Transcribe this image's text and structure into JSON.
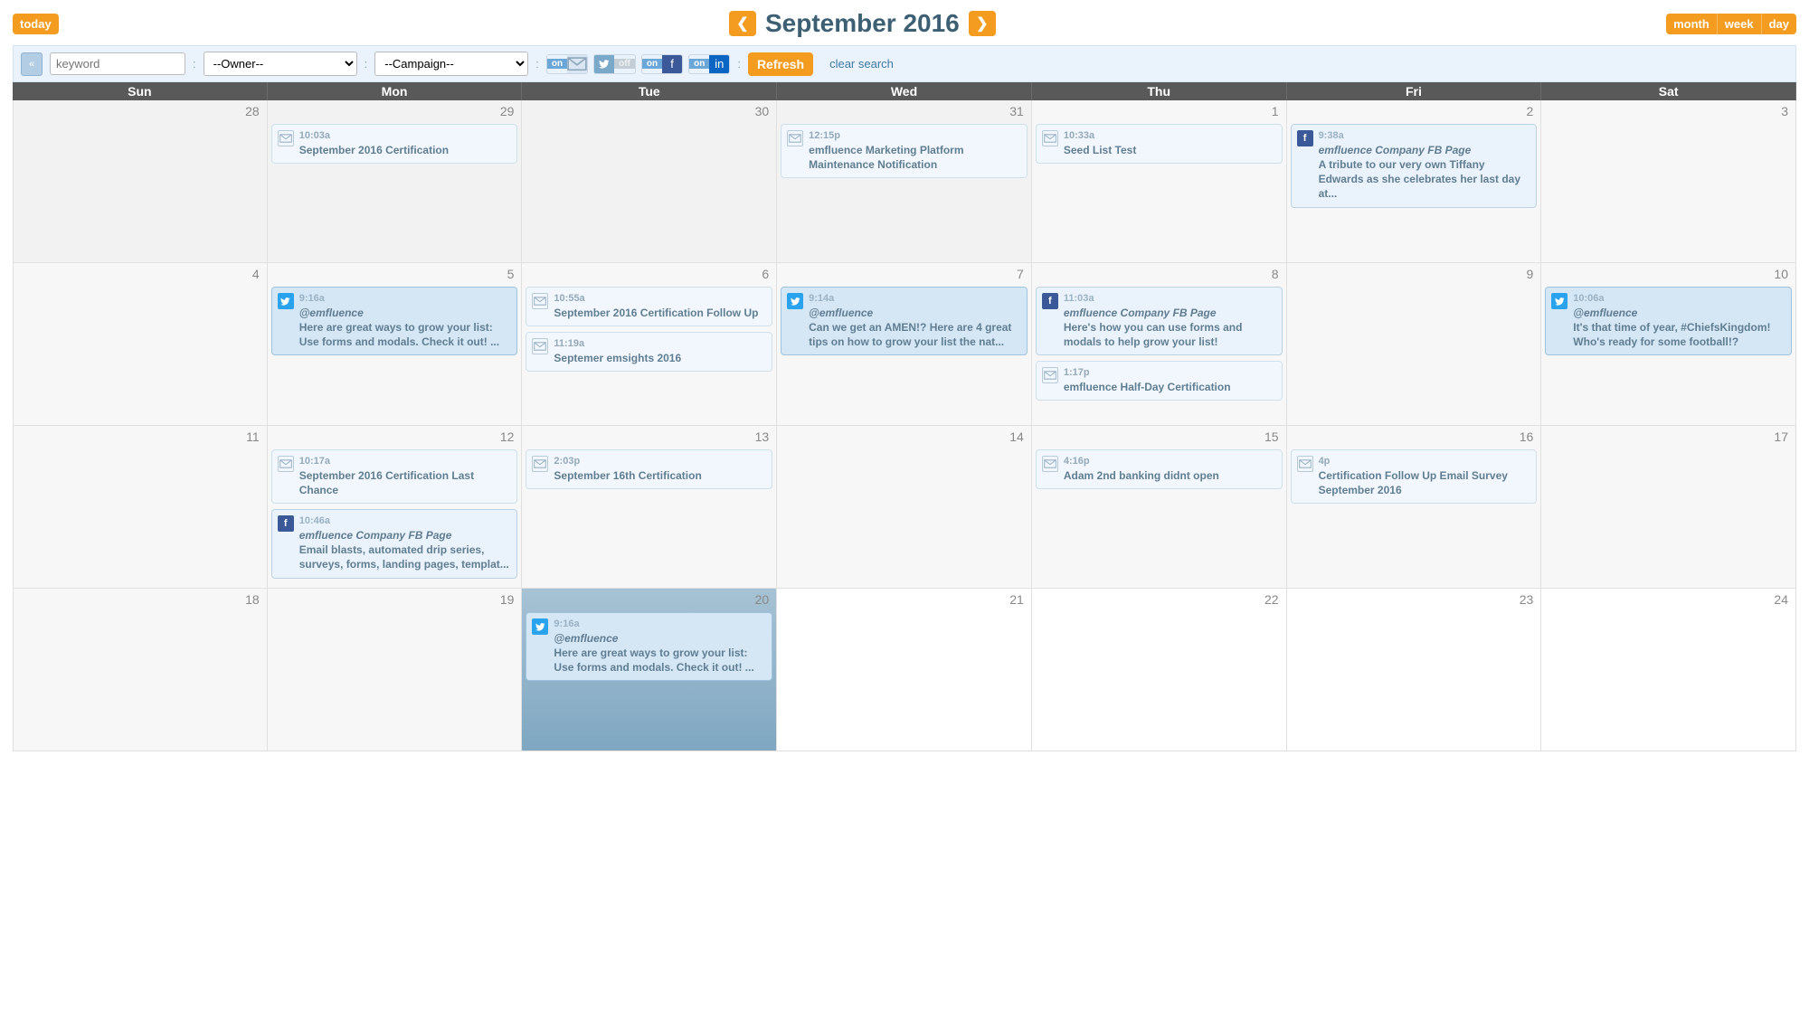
{
  "header": {
    "today_label": "today",
    "title": "September 2016",
    "views": {
      "month": "month",
      "week": "week",
      "day": "day"
    }
  },
  "filters": {
    "keyword_placeholder": "keyword",
    "owner_placeholder": "--Owner--",
    "campaign_placeholder": "--Campaign--",
    "refresh_label": "Refresh",
    "clear_label": "clear search",
    "toggles": {
      "email_on": "on",
      "twitter_off": "off",
      "facebook_on": "on",
      "linkedin_on": "on"
    }
  },
  "days": [
    "Sun",
    "Mon",
    "Tue",
    "Wed",
    "Thu",
    "Fri",
    "Sat"
  ],
  "cells": [
    {
      "num": "28",
      "out": true
    },
    {
      "num": "29",
      "out": true,
      "events": [
        {
          "type": "email",
          "variant": "light",
          "time": "10:03a",
          "subject": "September 2016 Certification"
        }
      ]
    },
    {
      "num": "30",
      "out": true
    },
    {
      "num": "31",
      "out": true,
      "events": [
        {
          "type": "email",
          "variant": "light",
          "time": "12:15p",
          "subject": "emfluence Marketing Platform Maintenance Notification"
        }
      ]
    },
    {
      "num": "1",
      "events": [
        {
          "type": "email",
          "variant": "light",
          "time": "10:33a",
          "subject": "Seed List Test"
        }
      ]
    },
    {
      "num": "2",
      "events": [
        {
          "type": "facebook",
          "time": "9:38a",
          "handle": "emfluence Company FB Page",
          "body": "A tribute to our very own Tiffany Edwards as she celebrates her last day at..."
        }
      ]
    },
    {
      "num": "3"
    },
    {
      "num": "4"
    },
    {
      "num": "5",
      "events": [
        {
          "type": "twitter",
          "variant": "tw",
          "time": "9:16a",
          "handle": "@emfluence",
          "body": "Here are great ways to grow your list: Use forms and modals. Check it out! ..."
        }
      ]
    },
    {
      "num": "6",
      "events": [
        {
          "type": "email",
          "variant": "light",
          "time": "10:55a",
          "subject": "September 2016 Certification Follow Up"
        },
        {
          "type": "email",
          "variant": "light",
          "time": "11:19a",
          "subject": "Septemer emsights 2016"
        }
      ]
    },
    {
      "num": "7",
      "events": [
        {
          "type": "twitter",
          "variant": "tw",
          "time": "9:14a",
          "handle": "@emfluence",
          "body": "Can we get an AMEN!? Here are 4 great tips on how to grow your list the nat..."
        }
      ]
    },
    {
      "num": "8",
      "events": [
        {
          "type": "facebook",
          "time": "11:03a",
          "handle": "emfluence Company FB Page",
          "body": "Here's how you can use forms and modals to help grow your list!"
        },
        {
          "type": "email",
          "variant": "light",
          "time": "1:17p",
          "subject": "emfluence Half-Day Certification"
        }
      ]
    },
    {
      "num": "9"
    },
    {
      "num": "10",
      "events": [
        {
          "type": "twitter",
          "variant": "tw",
          "time": "10:06a",
          "handle": "@emfluence",
          "body": "It's that time of year, #ChiefsKingdom! Who's ready for some football!?"
        }
      ]
    },
    {
      "num": "11"
    },
    {
      "num": "12",
      "events": [
        {
          "type": "email",
          "variant": "light",
          "time": "10:17a",
          "subject": "September 2016 Certification Last Chance"
        },
        {
          "type": "facebook",
          "time": "10:46a",
          "handle": "emfluence Company FB Page",
          "body": "Email blasts, automated drip series, surveys, forms, landing pages, templat..."
        }
      ]
    },
    {
      "num": "13",
      "events": [
        {
          "type": "email",
          "variant": "light",
          "time": "2:03p",
          "subject": "September 16th Certification"
        }
      ]
    },
    {
      "num": "14"
    },
    {
      "num": "15",
      "events": [
        {
          "type": "email",
          "variant": "light",
          "time": "4:16p",
          "subject": "Adam 2nd banking didnt open"
        }
      ]
    },
    {
      "num": "16",
      "events": [
        {
          "type": "email",
          "variant": "light",
          "time": "4p",
          "subject": "Certification Follow Up Email Survey September 2016"
        }
      ]
    },
    {
      "num": "17"
    },
    {
      "num": "18"
    },
    {
      "num": "19"
    },
    {
      "num": "20",
      "today": true,
      "events": [
        {
          "type": "twitter",
          "variant": "tw",
          "time": "9:16a",
          "handle": "@emfluence",
          "body": "Here are great ways to grow your list: Use forms and modals. Check it out! ..."
        }
      ]
    },
    {
      "num": "21",
      "future": true
    },
    {
      "num": "22",
      "future": true
    },
    {
      "num": "23",
      "future": true
    },
    {
      "num": "24",
      "future": true
    }
  ]
}
